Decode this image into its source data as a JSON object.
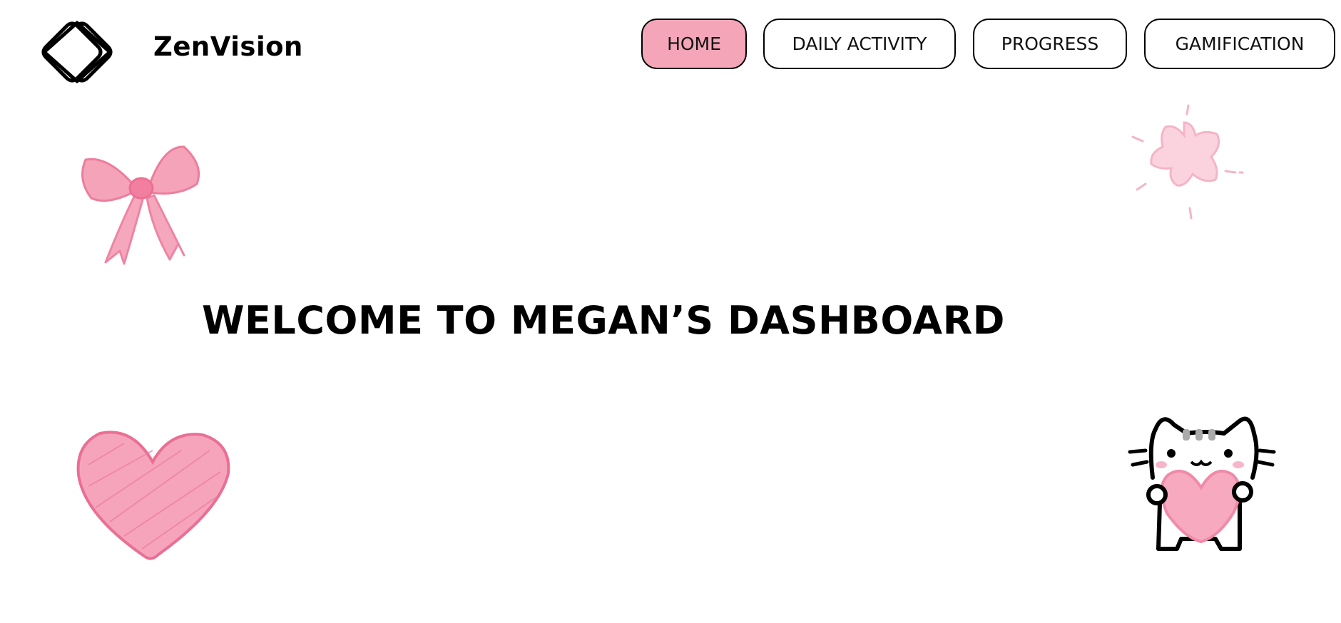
{
  "brand": {
    "name": "ZenVision",
    "logo_icon": "interlocking-diamond-logo"
  },
  "nav": {
    "items": [
      {
        "label": "HOME",
        "active": true
      },
      {
        "label": "DAILY ACTIVITY",
        "active": false
      },
      {
        "label": "PROGRESS",
        "active": false
      },
      {
        "label": "GAMIFICATION",
        "active": false
      }
    ]
  },
  "main": {
    "heading": "WELCOME TO MEGAN’S DASHBOARD"
  },
  "decorations": {
    "top_left": "pink-bow-icon",
    "top_right": "pink-star-icon",
    "bottom_left": "pink-heart-icon",
    "bottom_right": "cat-holding-heart-icon"
  },
  "colors": {
    "accent_pink": "#f4a5b8",
    "text": "#000000",
    "background": "#ffffff"
  }
}
